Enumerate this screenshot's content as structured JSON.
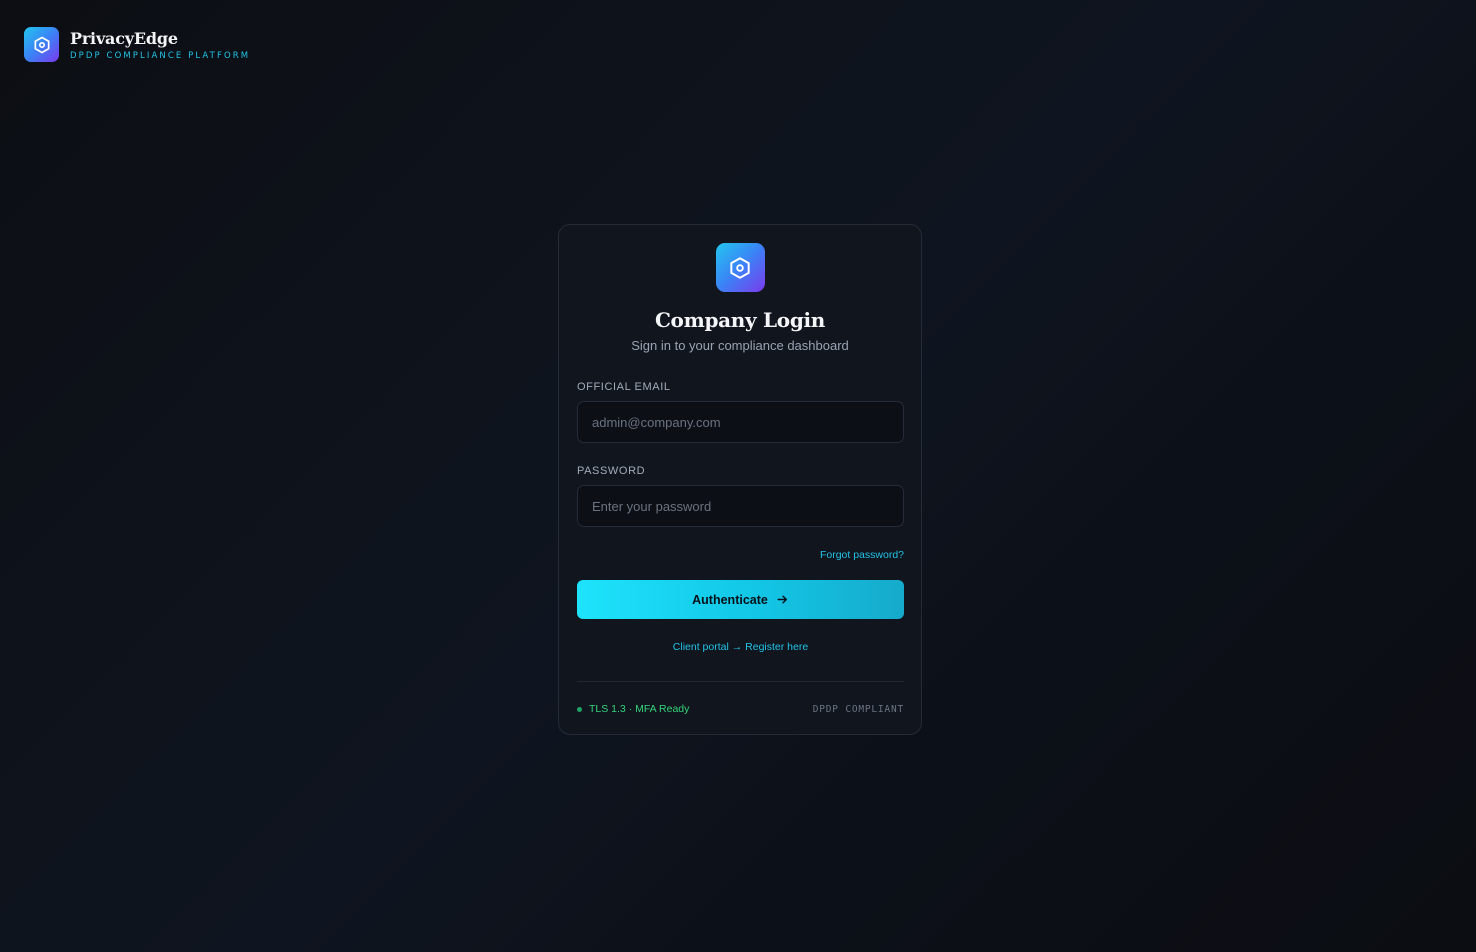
{
  "brand": {
    "name": "PrivacyEdge",
    "tagline": "DPDP COMPLIANCE PLATFORM",
    "logo_icon": "hexagon-shield-icon"
  },
  "card": {
    "logo_icon": "hexagon-shield-icon",
    "title": "Company Login",
    "subtitle": "Sign in to your compliance dashboard"
  },
  "form": {
    "email_label": "OFFICIAL EMAIL",
    "email_placeholder": "admin@company.com",
    "email_value": "",
    "password_label": "PASSWORD",
    "password_placeholder": "Enter your password",
    "password_value": "",
    "forgot_label": "Forgot password?",
    "submit_label": "Authenticate",
    "submit_icon": "arrow-right-icon"
  },
  "register": {
    "prefix": "Client portal",
    "arrow": "→",
    "link_label": "Register here"
  },
  "footer": {
    "status_text": "TLS 1.3 · MFA Ready",
    "compliance_badge": "DPDP COMPLIANT"
  },
  "colors": {
    "accent": "#22c3e6",
    "status_green": "#34d37b",
    "card_bg": "#11151e",
    "page_bg": "#0e131c"
  }
}
